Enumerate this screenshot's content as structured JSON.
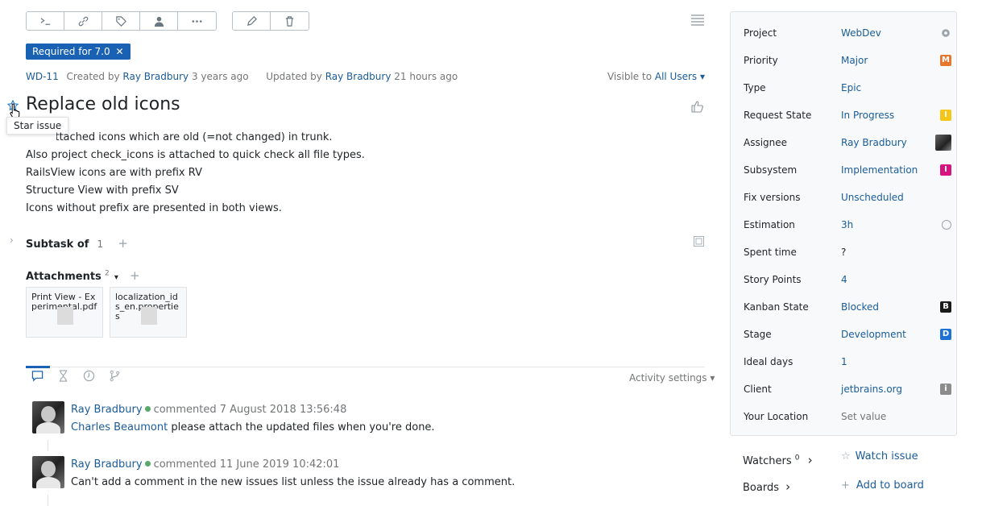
{
  "toolbar": {
    "group1": [
      "command-icon",
      "link-icon",
      "tag-icon",
      "user-icon",
      "more-icon"
    ],
    "group2": [
      "pencil-icon",
      "trash-icon"
    ]
  },
  "tag": {
    "label": "Required for 7.0",
    "close": "✕"
  },
  "issue": {
    "id": "WD-11",
    "created_prefix": "Created by",
    "created_by": "Ray Bradbury",
    "created_ago": "3 years ago",
    "updated_prefix": "Updated by",
    "updated_by": "Ray Bradbury",
    "updated_ago": "21 hours ago",
    "visible_prefix": "Visible to",
    "visible_to": "All Users ▾",
    "title": "Replace old icons",
    "star_tooltip": "Star issue",
    "description": [
      "See attached icons which are old (=not changed)  in trunk.",
      "Also project check_icons is attached to quick check all file types.",
      "RailsView icons are with prefix RV",
      "Structure View with prefix SV",
      "Icons without prefix are presented in both views."
    ]
  },
  "subtask": {
    "label": "Subtask of",
    "count": "1",
    "add": "+"
  },
  "attachments": {
    "label": "Attachments",
    "count": "2",
    "caret": "▾",
    "add": "+",
    "files": [
      "Print View - Experimental.pdf",
      "localization_ids_en.properties"
    ]
  },
  "activity": {
    "settings_label": "Activity settings ▾",
    "tabs": [
      "comments-tab-icon",
      "history-tab-icon",
      "timer-tab-icon",
      "vcs-tab-icon"
    ]
  },
  "comments": [
    {
      "author": "Ray Bradbury",
      "action": "commented",
      "date": "7 August 2018 13:56:48",
      "mention": "Charles Beaumont",
      "text": "please attach the updated files when you're done."
    },
    {
      "author": "Ray Bradbury",
      "action": "commented",
      "date": "11 June 2019 10:42:01",
      "mention": "",
      "text": "Can't add a comment in the new issues list unless the issue already has a comment."
    }
  ],
  "fields": [
    {
      "name": "Project",
      "value": "WebDev",
      "marker": "gear"
    },
    {
      "name": "Priority",
      "value": "Major",
      "marker": "badge",
      "badge": "M",
      "color": "#e8762c"
    },
    {
      "name": "Type",
      "value": "Epic",
      "marker": "none"
    },
    {
      "name": "Request State",
      "value": "In Progress",
      "marker": "badge",
      "badge": "I",
      "color": "#f5c518"
    },
    {
      "name": "Assignee",
      "value": "Ray Bradbury",
      "marker": "avatar"
    },
    {
      "name": "Subsystem",
      "value": "Implementation",
      "marker": "badge",
      "badge": "I",
      "color": "#d8127f"
    },
    {
      "name": "Fix versions",
      "value": "Unscheduled",
      "marker": "none"
    },
    {
      "name": "Estimation",
      "value": "3h",
      "marker": "ring"
    },
    {
      "name": "Spent time",
      "value": "?",
      "marker": "none",
      "style": "plain"
    },
    {
      "name": "Story Points",
      "value": "4",
      "marker": "none"
    },
    {
      "name": "Kanban State",
      "value": "Blocked",
      "marker": "badge",
      "badge": "B",
      "color": "#1a1a1a"
    },
    {
      "name": "Stage",
      "value": "Development",
      "marker": "badge",
      "badge": "D",
      "color": "#1b72d4"
    },
    {
      "name": "Ideal days",
      "value": "1",
      "marker": "none"
    },
    {
      "name": "Client",
      "value": "jetbrains.org",
      "marker": "badge",
      "badge": "i",
      "color": "#8c8c8c"
    },
    {
      "name": "Your Location",
      "value": "Set value",
      "marker": "none",
      "style": "muted"
    }
  ],
  "watchers": {
    "label": "Watchers",
    "count": "0",
    "chevron": "›",
    "action": "Watch issue",
    "star": "☆"
  },
  "boards": {
    "label": "Boards",
    "chevron": "›",
    "action": "Add to board",
    "plus": "+"
  }
}
